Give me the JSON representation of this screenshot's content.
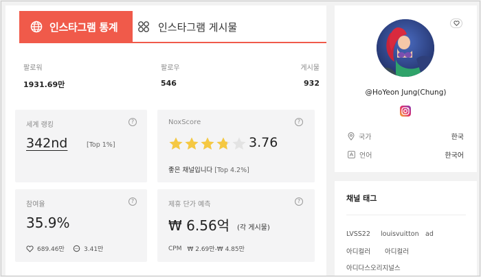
{
  "tabs": {
    "active": "인스타그램 통계",
    "inactive": "인스타그램 게시물"
  },
  "stats": {
    "followers_label": "팔로워",
    "followers_value": "1931.69만",
    "following_label": "팔로우",
    "following_value": "546",
    "posts_label": "게시물",
    "posts_value": "932"
  },
  "ranking": {
    "title": "세계 랭킹",
    "value": "342nd",
    "sub": "[Top 1%]"
  },
  "noxscore": {
    "title": "NoxScore",
    "score": "3.76",
    "stars": 3.76,
    "desc": "좋은 채널입니다",
    "desc_sub": "[Top 4.2%]"
  },
  "engagement": {
    "title": "참여율",
    "value": "35.9%",
    "likes": "689.46만",
    "comments": "3.41만"
  },
  "collab": {
    "title": "제휴 단가 예측",
    "value": "₩ 6.56억",
    "sub": "(각 게시물)",
    "cpm_label": "CPM",
    "cpm_value": "₩ 2.69만-₩ 4.85만"
  },
  "profile": {
    "name": "@HoYeon Jung(Chung)",
    "country_label": "국가",
    "country_value": "한국",
    "language_label": "언어",
    "language_value": "한국어"
  },
  "tags": {
    "title": "채널 태그",
    "items": [
      "LVSS22",
      "louisvuitton",
      "ad",
      "아디컬러",
      "아디컬러",
      "아디다스오리지널스"
    ]
  },
  "colors": {
    "accent": "#f05a4a",
    "star": "#f5c842",
    "card_bg": "#f4f4f5"
  }
}
